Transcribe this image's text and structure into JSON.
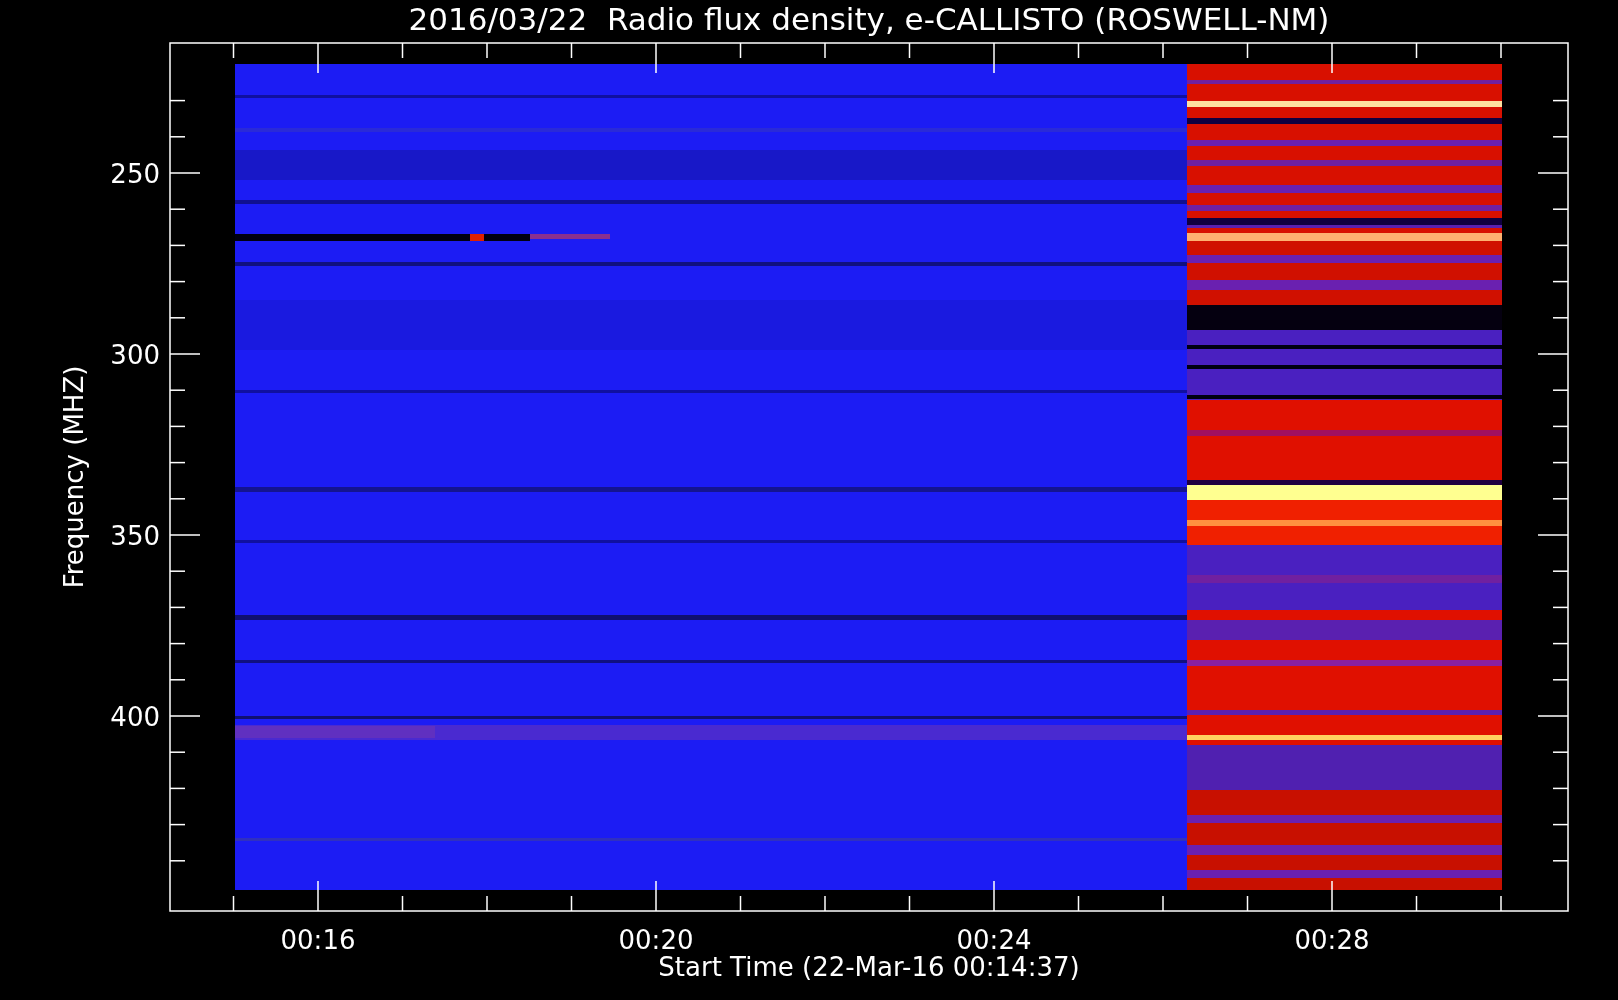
{
  "title": "2016/03/22  Radio flux density, e-CALLISTO (ROSWELL-NM)",
  "y_axis": {
    "label": "Frequency (MHZ)",
    "ticks": [
      "250",
      "300",
      "350",
      "400"
    ]
  },
  "x_axis": {
    "label": "Start Time (22-Mar-16 00:14:37)",
    "ticks": [
      "00:16",
      "00:20",
      "00:24",
      "00:28"
    ]
  }
}
